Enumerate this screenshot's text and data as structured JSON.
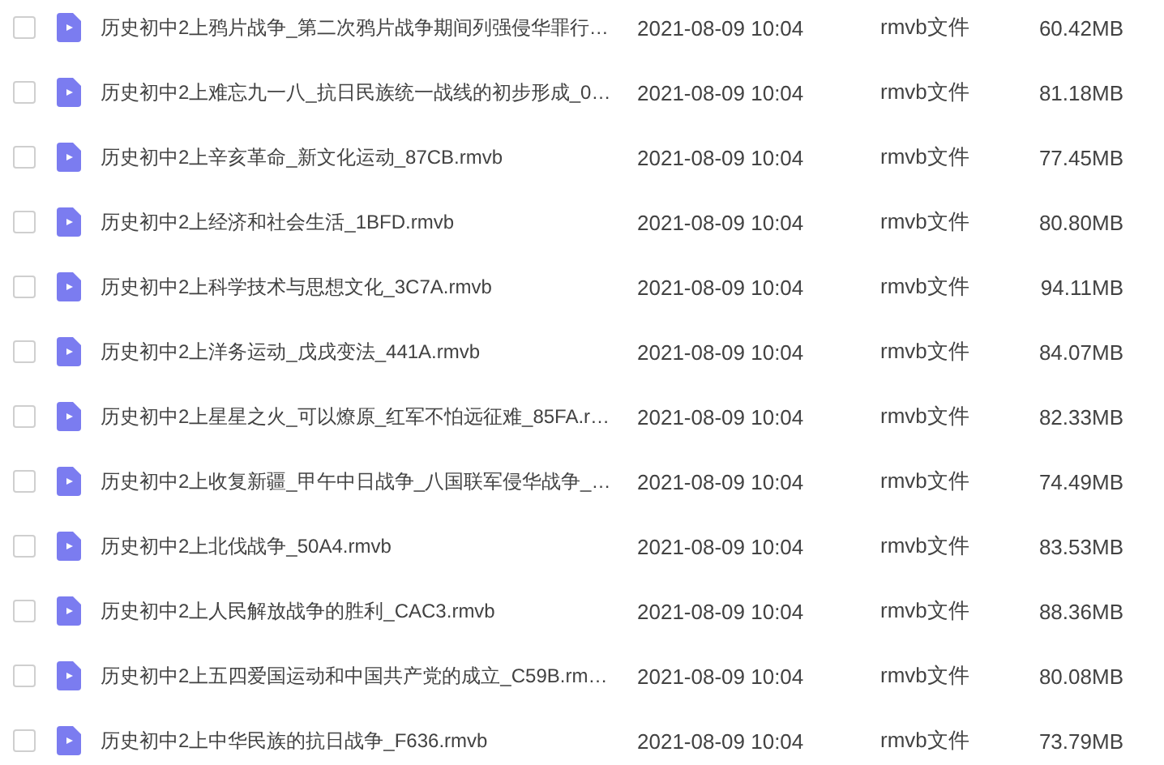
{
  "files": [
    {
      "name": "历史初中2上鸦片战争_第二次鸦片战争期间列强侵华罪行…",
      "date": "2021-08-09 10:04",
      "type": "rmvb文件",
      "size": "60.42MB",
      "checked": false
    },
    {
      "name": "历史初中2上难忘九一八_抗日民族统一战线的初步形成_0…",
      "date": "2021-08-09 10:04",
      "type": "rmvb文件",
      "size": "81.18MB",
      "checked": false
    },
    {
      "name": "历史初中2上辛亥革命_新文化运动_87CB.rmvb",
      "date": "2021-08-09 10:04",
      "type": "rmvb文件",
      "size": "77.45MB",
      "checked": false
    },
    {
      "name": "历史初中2上经济和社会生活_1BFD.rmvb",
      "date": "2021-08-09 10:04",
      "type": "rmvb文件",
      "size": "80.80MB",
      "checked": false
    },
    {
      "name": "历史初中2上科学技术与思想文化_3C7A.rmvb",
      "date": "2021-08-09 10:04",
      "type": "rmvb文件",
      "size": "94.11MB",
      "checked": false
    },
    {
      "name": "历史初中2上洋务运动_戊戌变法_441A.rmvb",
      "date": "2021-08-09 10:04",
      "type": "rmvb文件",
      "size": "84.07MB",
      "checked": false
    },
    {
      "name": "历史初中2上星星之火_可以燎原_红军不怕远征难_85FA.r…",
      "date": "2021-08-09 10:04",
      "type": "rmvb文件",
      "size": "82.33MB",
      "checked": false
    },
    {
      "name": "历史初中2上收复新疆_甲午中日战争_八国联军侵华战争_…",
      "date": "2021-08-09 10:04",
      "type": "rmvb文件",
      "size": "74.49MB",
      "checked": false
    },
    {
      "name": "历史初中2上北伐战争_50A4.rmvb",
      "date": "2021-08-09 10:04",
      "type": "rmvb文件",
      "size": "83.53MB",
      "checked": false
    },
    {
      "name": "历史初中2上人民解放战争的胜利_CAC3.rmvb",
      "date": "2021-08-09 10:04",
      "type": "rmvb文件",
      "size": "88.36MB",
      "checked": false
    },
    {
      "name": "历史初中2上五四爱国运动和中国共产党的成立_C59B.rm…",
      "date": "2021-08-09 10:04",
      "type": "rmvb文件",
      "size": "80.08MB",
      "checked": false
    },
    {
      "name": "历史初中2上中华民族的抗日战争_F636.rmvb",
      "date": "2021-08-09 10:04",
      "type": "rmvb文件",
      "size": "73.79MB",
      "checked": false
    }
  ]
}
